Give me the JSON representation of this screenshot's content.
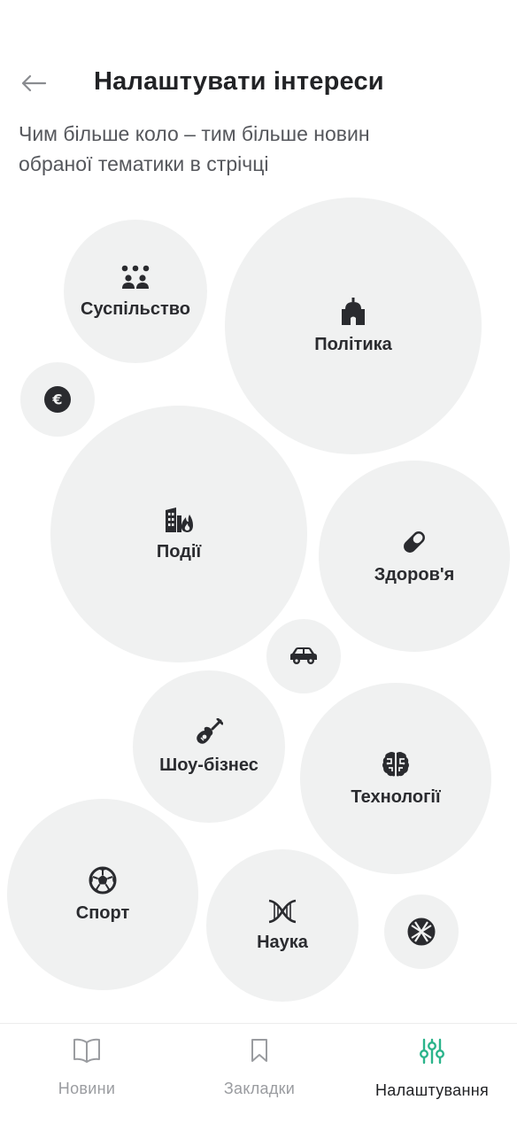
{
  "header": {
    "title": "Налаштувати інтереси",
    "back_icon": "arrow-left-icon"
  },
  "subtitle": {
    "line1": "Чим більше коло – тим більше новин",
    "line2": "обраної тематики в стрічці"
  },
  "topics": [
    {
      "label": "Суспільство",
      "icon": "people-icon"
    },
    {
      "label": "Політика",
      "icon": "government-building-icon"
    },
    {
      "label": "",
      "icon": "euro-icon"
    },
    {
      "label": "Події",
      "icon": "city-fire-icon"
    },
    {
      "label": "Здоров'я",
      "icon": "pill-icon"
    },
    {
      "label": "",
      "icon": "car-icon"
    },
    {
      "label": "Шоу-бізнес",
      "icon": "guitar-icon"
    },
    {
      "label": "Технології",
      "icon": "brain-chip-icon"
    },
    {
      "label": "Спорт",
      "icon": "soccer-ball-icon"
    },
    {
      "label": "Наука",
      "icon": "dna-icon"
    },
    {
      "label": "",
      "icon": "globe-icon"
    }
  ],
  "bottom_nav": [
    {
      "label": "Новини",
      "icon": "book-icon",
      "active": false
    },
    {
      "label": "Закладки",
      "icon": "bookmark-icon",
      "active": false
    },
    {
      "label": "Налаштування",
      "icon": "sliders-icon",
      "active": true
    }
  ],
  "colors": {
    "bubble_bg": "#f0f1f1",
    "icon_dark": "#2a2b2f",
    "accent": "#2bb48b",
    "nav_inactive": "#9a9ca0"
  }
}
